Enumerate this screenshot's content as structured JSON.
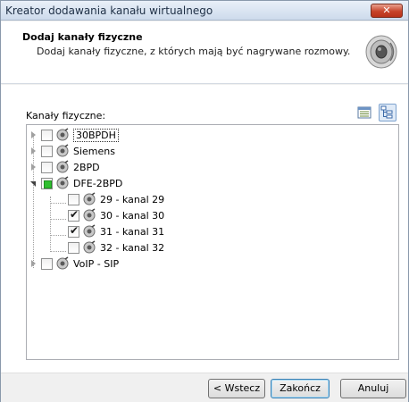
{
  "window": {
    "title": "Kreator dodawania kanału wirtualnego",
    "close_label": "✕"
  },
  "header": {
    "title": "Dodaj kanały fizyczne",
    "subtitle": "Dodaj kanały fizyczne, z których mają być nagrywane rozmowy."
  },
  "tree": {
    "label": "Kanały fizyczne:",
    "items": [
      {
        "label": "30BPDH",
        "expander": "closed",
        "check": "none",
        "level": 0
      },
      {
        "label": "Siemens",
        "expander": "closed",
        "check": "none",
        "level": 0
      },
      {
        "label": "2BPD",
        "expander": "closed",
        "check": "none",
        "level": 0
      },
      {
        "label": "DFE-2BPD",
        "expander": "open",
        "check": "partial",
        "level": 0
      },
      {
        "label": "29 - kanal 29",
        "expander": "none",
        "check": "none",
        "level": 1
      },
      {
        "label": "30 - kanal 30",
        "expander": "none",
        "check": "checked",
        "level": 1
      },
      {
        "label": "31 - kanal 31",
        "expander": "none",
        "check": "checked",
        "level": 1
      },
      {
        "label": "32 - kanal 32",
        "expander": "none",
        "check": "none",
        "level": 1
      },
      {
        "label": "VoIP - SIP",
        "expander": "closed",
        "check": "none",
        "level": 0
      }
    ]
  },
  "buttons": {
    "back": "< Wstecz",
    "finish": "Zakończ",
    "cancel": "Anuluj"
  },
  "icons": {
    "view_list": "list-view-icon",
    "view_tree": "tree-view-icon",
    "header": "speaker-icon",
    "node": "phone-channel-icon"
  },
  "colors": {
    "partial_check": "#2fbf2f",
    "close_button": "#c7432a",
    "selection_border": "#7da2ce"
  }
}
